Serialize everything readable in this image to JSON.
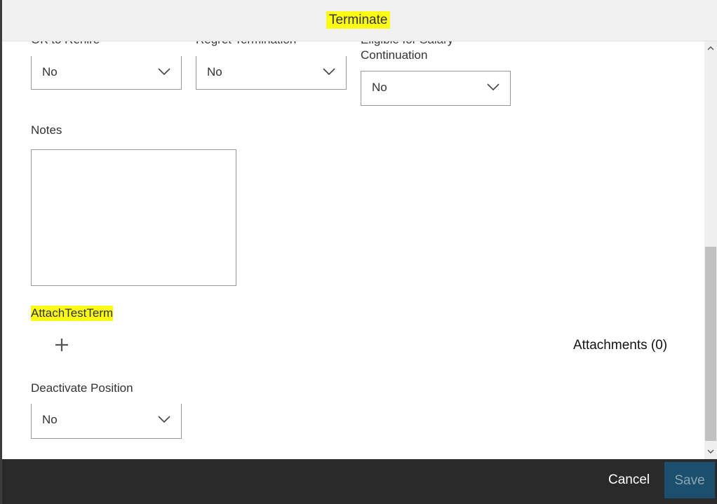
{
  "dialog": {
    "title": "Terminate"
  },
  "form": {
    "ok_to_rehire": {
      "label": "OK to Rehire",
      "value": "No"
    },
    "regret_termination": {
      "label": "Regret Termination",
      "value": "No"
    },
    "eligible_salary_continuation": {
      "label_line1": "Eligible for Salary",
      "label_line2": "Continuation",
      "value": "No"
    },
    "notes": {
      "label": "Notes",
      "value": ""
    },
    "attachment_section": {
      "label": "AttachTestTerm",
      "count_label": "Attachments (0)"
    },
    "deactivate_position": {
      "label": "Deactivate Position",
      "value": "No"
    }
  },
  "footer": {
    "cancel_label": "Cancel",
    "save_label": "Save"
  },
  "colors": {
    "highlight": "#fbfb16",
    "footer_bg": "#2a2a2a",
    "save_bg": "#1c4f6e"
  },
  "icons": {
    "dropdown": "chevron-down-icon",
    "add": "plus-icon",
    "scroll_up": "chevron-up-icon",
    "scroll_down": "chevron-down-icon"
  }
}
